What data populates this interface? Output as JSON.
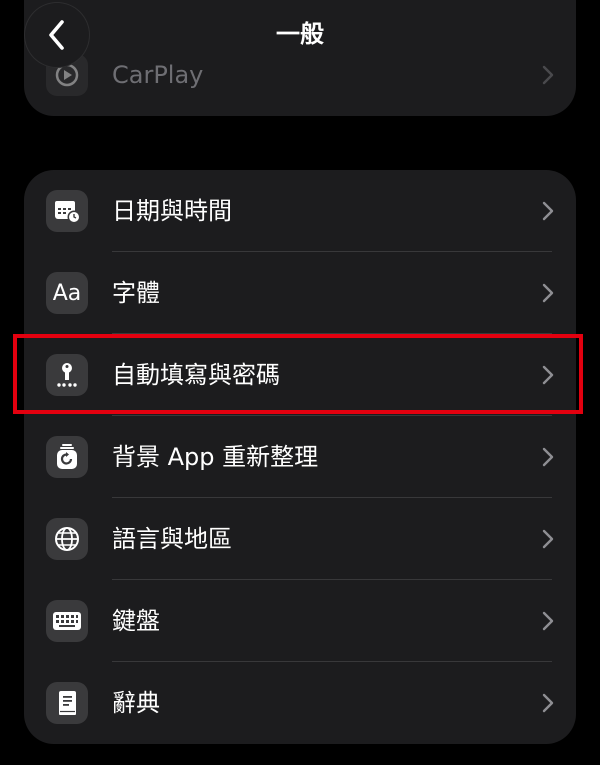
{
  "nav": {
    "title": "一般"
  },
  "top_group": {
    "carplay_label": "CarPlay"
  },
  "settings": [
    {
      "label": "日期與時間",
      "icon": "calendar-clock-icon"
    },
    {
      "label": "字體",
      "icon": "font-aa-icon",
      "icon_text": "Aa"
    },
    {
      "label": "自動填寫與密碼",
      "icon": "key-autofill-icon"
    },
    {
      "label": "背景 App 重新整理",
      "icon": "background-refresh-icon"
    },
    {
      "label": "語言與地區",
      "icon": "globe-icon"
    },
    {
      "label": "鍵盤",
      "icon": "keyboard-icon"
    },
    {
      "label": "辭典",
      "icon": "dictionary-book-icon"
    }
  ],
  "highlight_color": "#e3000f"
}
